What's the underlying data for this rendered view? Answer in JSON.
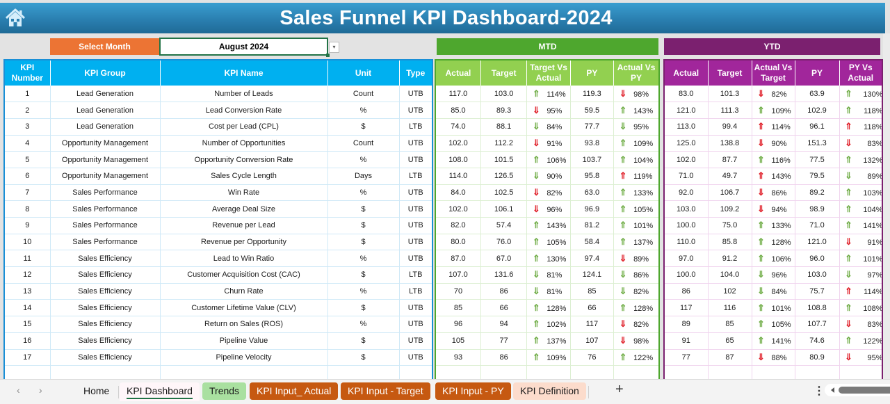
{
  "title": "Sales Funnel KPI Dashboard-2024",
  "home_icon": "home-icon",
  "select_month": {
    "label": "Select Month",
    "value": "August 2024",
    "dropdown_icon": "▾"
  },
  "sections": {
    "mtd": "MTD",
    "ytd": "YTD"
  },
  "kpi_headers": [
    "KPI Number",
    "KPI Group",
    "KPI Name",
    "Unit",
    "Type"
  ],
  "mtd_headers": [
    "Actual",
    "Target",
    "Target Vs Actual",
    "PY",
    "Actual Vs PY"
  ],
  "ytd_headers": [
    "Actual",
    "Target",
    "Actual Vs Target",
    "PY",
    "PY Vs Actual"
  ],
  "colors": {
    "up_good": "#70ad47",
    "down_bad": "#e0202a",
    "mtd": "#4ea72e",
    "ytd": "#7b206f",
    "kpi": "#00b0f0",
    "select": "#ec7434"
  },
  "rows": [
    {
      "num": "1",
      "group": "Lead Generation",
      "name": "Number of Leads",
      "unit": "Count",
      "type": "UTB",
      "mtd": {
        "actual": "117.0",
        "target": "103.0",
        "tva": "114%",
        "tva_dir": "up",
        "tva_color": "green",
        "py": "119.3",
        "avp": "98%",
        "avp_dir": "down",
        "avp_color": "red"
      },
      "ytd": {
        "actual": "83.0",
        "target": "101.3",
        "avt": "82%",
        "avt_dir": "down",
        "avt_color": "red",
        "py": "63.9",
        "pva": "130%",
        "pva_dir": "up",
        "pva_color": "green"
      }
    },
    {
      "num": "2",
      "group": "Lead Generation",
      "name": "Lead Conversion Rate",
      "unit": "%",
      "type": "UTB",
      "mtd": {
        "actual": "85.0",
        "target": "89.3",
        "tva": "95%",
        "tva_dir": "down",
        "tva_color": "red",
        "py": "59.5",
        "avp": "143%",
        "avp_dir": "up",
        "avp_color": "green"
      },
      "ytd": {
        "actual": "121.0",
        "target": "111.3",
        "avt": "109%",
        "avt_dir": "up",
        "avt_color": "green",
        "py": "102.9",
        "pva": "118%",
        "pva_dir": "up",
        "pva_color": "green"
      }
    },
    {
      "num": "3",
      "group": "Lead Generation",
      "name": "Cost per Lead (CPL)",
      "unit": "$",
      "type": "LTB",
      "mtd": {
        "actual": "74.0",
        "target": "88.1",
        "tva": "84%",
        "tva_dir": "down",
        "tva_color": "green",
        "py": "77.7",
        "avp": "95%",
        "avp_dir": "down",
        "avp_color": "green"
      },
      "ytd": {
        "actual": "113.0",
        "target": "99.4",
        "avt": "114%",
        "avt_dir": "up",
        "avt_color": "red",
        "py": "96.1",
        "pva": "118%",
        "pva_dir": "up",
        "pva_color": "red"
      }
    },
    {
      "num": "4",
      "group": "Opportunity Management",
      "name": "Number of Opportunities",
      "unit": "Count",
      "type": "UTB",
      "mtd": {
        "actual": "102.0",
        "target": "112.2",
        "tva": "91%",
        "tva_dir": "down",
        "tva_color": "red",
        "py": "93.8",
        "avp": "109%",
        "avp_dir": "up",
        "avp_color": "green"
      },
      "ytd": {
        "actual": "125.0",
        "target": "138.8",
        "avt": "90%",
        "avt_dir": "down",
        "avt_color": "red",
        "py": "151.3",
        "pva": "83%",
        "pva_dir": "down",
        "pva_color": "red"
      }
    },
    {
      "num": "5",
      "group": "Opportunity Management",
      "name": "Opportunity Conversion Rate",
      "unit": "%",
      "type": "UTB",
      "mtd": {
        "actual": "108.0",
        "target": "101.5",
        "tva": "106%",
        "tva_dir": "up",
        "tva_color": "green",
        "py": "103.7",
        "avp": "104%",
        "avp_dir": "up",
        "avp_color": "green"
      },
      "ytd": {
        "actual": "102.0",
        "target": "87.7",
        "avt": "116%",
        "avt_dir": "up",
        "avt_color": "green",
        "py": "77.5",
        "pva": "132%",
        "pva_dir": "up",
        "pva_color": "green"
      }
    },
    {
      "num": "6",
      "group": "Opportunity Management",
      "name": "Sales Cycle Length",
      "unit": "Days",
      "type": "LTB",
      "mtd": {
        "actual": "114.0",
        "target": "126.5",
        "tva": "90%",
        "tva_dir": "down",
        "tva_color": "green",
        "py": "95.8",
        "avp": "119%",
        "avp_dir": "up",
        "avp_color": "red"
      },
      "ytd": {
        "actual": "71.0",
        "target": "49.7",
        "avt": "143%",
        "avt_dir": "up",
        "avt_color": "red",
        "py": "79.5",
        "pva": "89%",
        "pva_dir": "down",
        "pva_color": "green"
      }
    },
    {
      "num": "7",
      "group": "Sales Performance",
      "name": "Win Rate",
      "unit": "%",
      "type": "UTB",
      "mtd": {
        "actual": "84.0",
        "target": "102.5",
        "tva": "82%",
        "tva_dir": "down",
        "tva_color": "red",
        "py": "63.0",
        "avp": "133%",
        "avp_dir": "up",
        "avp_color": "green"
      },
      "ytd": {
        "actual": "92.0",
        "target": "106.7",
        "avt": "86%",
        "avt_dir": "down",
        "avt_color": "red",
        "py": "89.2",
        "pva": "103%",
        "pva_dir": "up",
        "pva_color": "green"
      }
    },
    {
      "num": "8",
      "group": "Sales Performance",
      "name": "Average Deal Size",
      "unit": "$",
      "type": "UTB",
      "mtd": {
        "actual": "102.0",
        "target": "106.1",
        "tva": "96%",
        "tva_dir": "down",
        "tva_color": "red",
        "py": "96.9",
        "avp": "105%",
        "avp_dir": "up",
        "avp_color": "green"
      },
      "ytd": {
        "actual": "103.0",
        "target": "109.2",
        "avt": "94%",
        "avt_dir": "down",
        "avt_color": "red",
        "py": "98.9",
        "pva": "104%",
        "pva_dir": "up",
        "pva_color": "green"
      }
    },
    {
      "num": "9",
      "group": "Sales Performance",
      "name": "Revenue per Lead",
      "unit": "$",
      "type": "UTB",
      "mtd": {
        "actual": "82.0",
        "target": "57.4",
        "tva": "143%",
        "tva_dir": "up",
        "tva_color": "green",
        "py": "81.2",
        "avp": "101%",
        "avp_dir": "up",
        "avp_color": "green"
      },
      "ytd": {
        "actual": "100.0",
        "target": "75.0",
        "avt": "133%",
        "avt_dir": "up",
        "avt_color": "green",
        "py": "71.0",
        "pva": "141%",
        "pva_dir": "up",
        "pva_color": "green"
      }
    },
    {
      "num": "10",
      "group": "Sales Performance",
      "name": "Revenue per Opportunity",
      "unit": "$",
      "type": "UTB",
      "mtd": {
        "actual": "80.0",
        "target": "76.0",
        "tva": "105%",
        "tva_dir": "up",
        "tva_color": "green",
        "py": "58.4",
        "avp": "137%",
        "avp_dir": "up",
        "avp_color": "green"
      },
      "ytd": {
        "actual": "110.0",
        "target": "85.8",
        "avt": "128%",
        "avt_dir": "up",
        "avt_color": "green",
        "py": "121.0",
        "pva": "91%",
        "pva_dir": "down",
        "pva_color": "red"
      }
    },
    {
      "num": "11",
      "group": "Sales Efficiency",
      "name": "Lead to Win Ratio",
      "unit": "%",
      "type": "UTB",
      "mtd": {
        "actual": "87.0",
        "target": "67.0",
        "tva": "130%",
        "tva_dir": "up",
        "tva_color": "green",
        "py": "97.4",
        "avp": "89%",
        "avp_dir": "down",
        "avp_color": "red"
      },
      "ytd": {
        "actual": "97.0",
        "target": "91.2",
        "avt": "106%",
        "avt_dir": "up",
        "avt_color": "green",
        "py": "96.0",
        "pva": "101%",
        "pva_dir": "up",
        "pva_color": "green"
      }
    },
    {
      "num": "12",
      "group": "Sales Efficiency",
      "name": "Customer Acquisition Cost (CAC)",
      "unit": "$",
      "type": "LTB",
      "mtd": {
        "actual": "107.0",
        "target": "131.6",
        "tva": "81%",
        "tva_dir": "down",
        "tva_color": "green",
        "py": "124.1",
        "avp": "86%",
        "avp_dir": "down",
        "avp_color": "green"
      },
      "ytd": {
        "actual": "100.0",
        "target": "104.0",
        "avt": "96%",
        "avt_dir": "down",
        "avt_color": "green",
        "py": "103.0",
        "pva": "97%",
        "pva_dir": "down",
        "pva_color": "green"
      }
    },
    {
      "num": "13",
      "group": "Sales Efficiency",
      "name": "Churn Rate",
      "unit": "%",
      "type": "LTB",
      "mtd": {
        "actual": "70",
        "target": "86",
        "tva": "81%",
        "tva_dir": "down",
        "tva_color": "green",
        "py": "85",
        "avp": "82%",
        "avp_dir": "down",
        "avp_color": "green"
      },
      "ytd": {
        "actual": "86",
        "target": "102",
        "avt": "84%",
        "avt_dir": "down",
        "avt_color": "green",
        "py": "75.7",
        "pva": "114%",
        "pva_dir": "up",
        "pva_color": "red"
      }
    },
    {
      "num": "14",
      "group": "Sales Efficiency",
      "name": "Customer Lifetime Value (CLV)",
      "unit": "$",
      "type": "UTB",
      "mtd": {
        "actual": "85",
        "target": "66",
        "tva": "128%",
        "tva_dir": "up",
        "tva_color": "green",
        "py": "66",
        "avp": "128%",
        "avp_dir": "up",
        "avp_color": "green"
      },
      "ytd": {
        "actual": "117",
        "target": "116",
        "avt": "101%",
        "avt_dir": "up",
        "avt_color": "green",
        "py": "108.8",
        "pva": "108%",
        "pva_dir": "up",
        "pva_color": "green"
      }
    },
    {
      "num": "15",
      "group": "Sales Efficiency",
      "name": "Return on Sales (ROS)",
      "unit": "%",
      "type": "UTB",
      "mtd": {
        "actual": "96",
        "target": "94",
        "tva": "102%",
        "tva_dir": "up",
        "tva_color": "green",
        "py": "117",
        "avp": "82%",
        "avp_dir": "down",
        "avp_color": "red"
      },
      "ytd": {
        "actual": "89",
        "target": "85",
        "avt": "105%",
        "avt_dir": "up",
        "avt_color": "green",
        "py": "107.7",
        "pva": "83%",
        "pva_dir": "down",
        "pva_color": "red"
      }
    },
    {
      "num": "16",
      "group": "Sales Efficiency",
      "name": "Pipeline Value",
      "unit": "$",
      "type": "UTB",
      "mtd": {
        "actual": "105",
        "target": "77",
        "tva": "137%",
        "tva_dir": "up",
        "tva_color": "green",
        "py": "107",
        "avp": "98%",
        "avp_dir": "down",
        "avp_color": "red"
      },
      "ytd": {
        "actual": "91",
        "target": "65",
        "avt": "141%",
        "avt_dir": "up",
        "avt_color": "green",
        "py": "74.6",
        "pva": "122%",
        "pva_dir": "up",
        "pva_color": "green"
      }
    },
    {
      "num": "17",
      "group": "Sales Efficiency",
      "name": "Pipeline Velocity",
      "unit": "$",
      "type": "UTB",
      "mtd": {
        "actual": "93",
        "target": "86",
        "tva": "109%",
        "tva_dir": "up",
        "tva_color": "green",
        "py": "76",
        "avp": "122%",
        "avp_dir": "up",
        "avp_color": "green"
      },
      "ytd": {
        "actual": "77",
        "target": "87",
        "avt": "88%",
        "avt_dir": "down",
        "avt_color": "red",
        "py": "80.9",
        "pva": "95%",
        "pva_dir": "down",
        "pva_color": "red"
      }
    }
  ],
  "sheet_tabs": {
    "prev": "‹",
    "next": "›",
    "home": "Home",
    "dashboard": "KPI Dashboard",
    "trends": "Trends",
    "input_actual": "KPI Input_ Actual",
    "input_target": "KPI Input - Target",
    "input_py": "KPI Input - PY",
    "definition": "KPI Definition",
    "add": "+",
    "more": "⋮"
  }
}
